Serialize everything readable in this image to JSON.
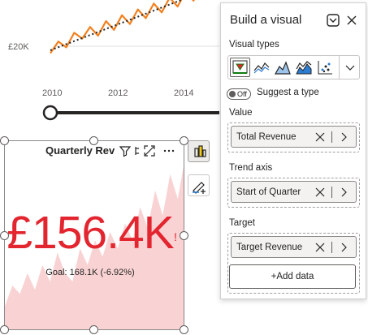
{
  "chart_data": {
    "type": "line",
    "x_tick_labels": [
      "2010",
      "2012",
      "2014"
    ],
    "y_tick_labels": [
      "£20K"
    ],
    "series": [
      {
        "style": "solid",
        "color": "#f2801f",
        "values": [
          19,
          23,
          21,
          26,
          24,
          28,
          25,
          30,
          27,
          32,
          29,
          34,
          31,
          36,
          33,
          38,
          35,
          40,
          37,
          42
        ]
      },
      {
        "style": "dotted",
        "color": "#252423",
        "values": [
          20,
          42
        ]
      }
    ]
  },
  "slider": {
    "value": 0
  },
  "kpi": {
    "title": "Quarterly Rev",
    "value": "£156.4K",
    "exclamation": "!",
    "goal": "Goal: 168.1K (-6.92%)",
    "color": "#e3252f",
    "trend_fill": "#f9d3d4",
    "trend_values": [
      30,
      55,
      45,
      70,
      50,
      80,
      60,
      95,
      70,
      60,
      100,
      80,
      110,
      90,
      120,
      100,
      130,
      110,
      150,
      125,
      170,
      140,
      190,
      160,
      210
    ]
  },
  "pane": {
    "title": "Build a visual",
    "visual_types_label": "Visual types",
    "visual_types": [
      "kpi-icon",
      "line-chart-icon",
      "area-chart-icon",
      "stacked-area-icon",
      "scatter-icon"
    ],
    "suggest_toggle_state": "Off",
    "suggest_label": "Suggest a type",
    "value_label": "Value",
    "value_field": "Total Revenue",
    "trend_label": "Trend axis",
    "trend_field": "Start of Quarter",
    "target_label": "Target",
    "target_field": "Target Revenue",
    "add_data_label": "+Add data"
  }
}
